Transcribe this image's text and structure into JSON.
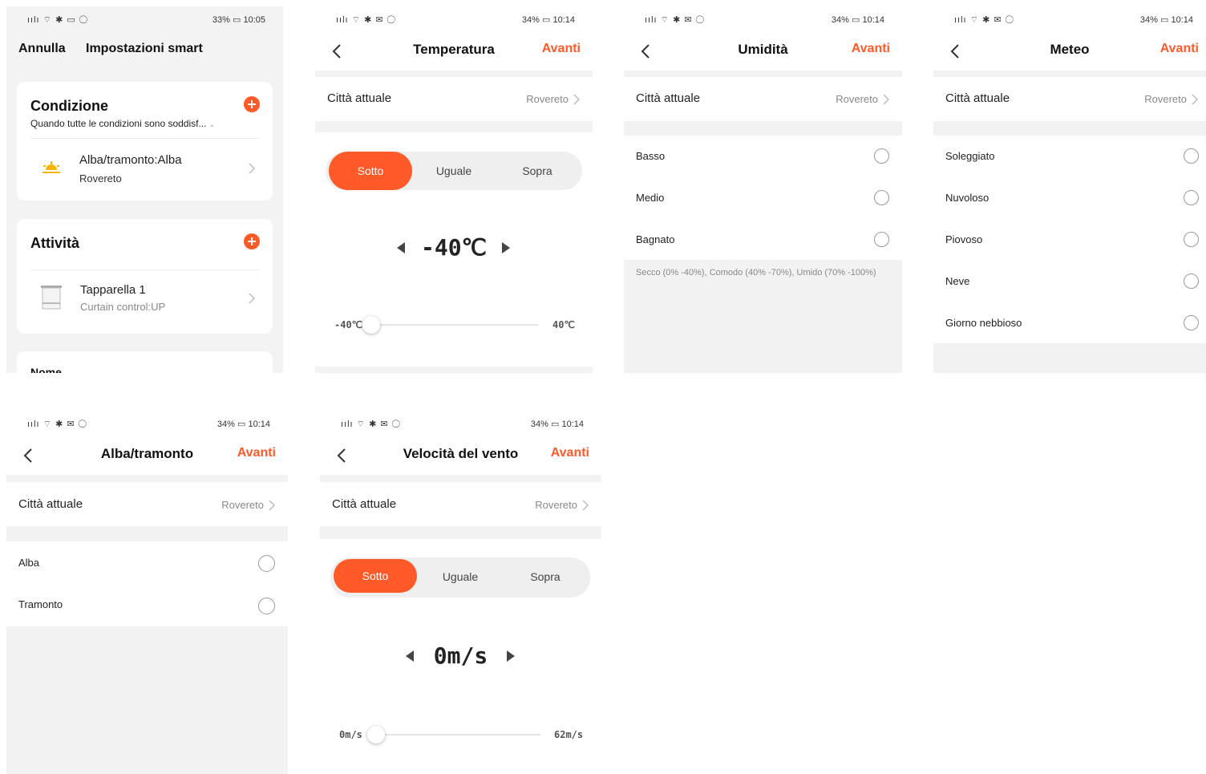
{
  "screen1": {
    "status": {
      "signals": "ıılı ⌔ ✱ ▭ ◯",
      "battery": "33%",
      "time": "10:05"
    },
    "cancel": "Annulla",
    "title": "Impostazioni smart",
    "condition": {
      "title": "Condizione",
      "subtitle": "Quando tutte le condizioni sono soddisf...",
      "item_title": "Alba/tramonto:Alba",
      "item_sub": "Rovereto"
    },
    "activity": {
      "title": "Attività",
      "item_title": "Tapparella 1",
      "item_sub": "Curtain control:UP"
    },
    "name_label": "Nome"
  },
  "screen2": {
    "status": {
      "signals": "ıılı ⌔ ✱ ✉ ◯",
      "battery": "34%",
      "time": "10:14"
    },
    "title": "Temperatura",
    "next": "Avanti",
    "city_label": "Città attuale",
    "city_value": "Rovereto",
    "segments": [
      "Sotto",
      "Uguale",
      "Sopra"
    ],
    "value": "-40℃",
    "min": "-40℃",
    "max": "40℃",
    "slider_fraction": 0
  },
  "screen3": {
    "status": {
      "signals": "ıılı ⌔ ✱ ✉ ◯",
      "battery": "34%",
      "time": "10:14"
    },
    "title": "Umidità",
    "next": "Avanti",
    "city_label": "Città attuale",
    "city_value": "Rovereto",
    "options": [
      "Basso",
      "Medio",
      "Bagnato"
    ],
    "note": "Secco (0% -40%), Comodo (40% -70%), Umido (70% -100%)"
  },
  "screen4": {
    "status": {
      "signals": "ıılı ⌔ ✱ ✉ ◯",
      "battery": "34%",
      "time": "10:14"
    },
    "title": "Meteo",
    "next": "Avanti",
    "city_label": "Città attuale",
    "city_value": "Rovereto",
    "options": [
      "Soleggiato",
      "Nuvoloso",
      "Piovoso",
      "Neve",
      "Giorno nebbioso"
    ]
  },
  "screen5": {
    "status": {
      "signals": "ıılı ⌔ ✱ ✉ ◯",
      "battery": "34%",
      "time": "10:14"
    },
    "title": "Alba/tramonto",
    "next": "Avanti",
    "city_label": "Città attuale",
    "city_value": "Rovereto",
    "options": [
      "Alba",
      "Tramonto"
    ]
  },
  "screen6": {
    "status": {
      "signals": "ıılı ⌔ ✱ ✉ ◯",
      "battery": "34%",
      "time": "10:14"
    },
    "title": "Velocità del vento",
    "next": "Avanti",
    "city_label": "Città attuale",
    "city_value": "Rovereto",
    "segments": [
      "Sotto",
      "Uguale",
      "Sopra"
    ],
    "value": "0m/s",
    "min": "0m/s",
    "max": "62m/s",
    "slider_fraction": 0
  },
  "colors": {
    "accent": "#ff5a28"
  }
}
